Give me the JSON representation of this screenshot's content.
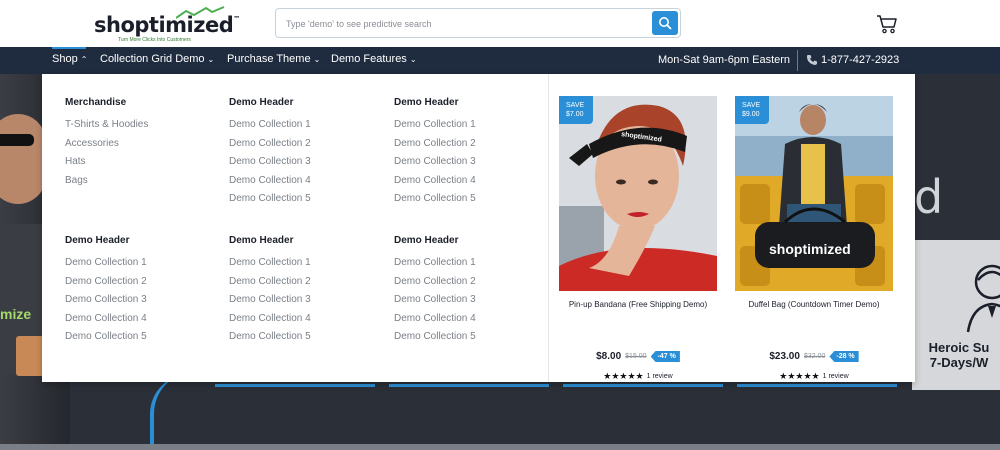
{
  "header": {
    "logo_text": "shoptimized",
    "logo_tm": "™",
    "logo_tagline": "Turn More Clicks Into Customers",
    "search_placeholder": "Type 'demo' to see predictive search"
  },
  "nav": {
    "items": [
      {
        "label": "Shop"
      },
      {
        "label": "Collection Grid Demo"
      },
      {
        "label": "Purchase Theme"
      },
      {
        "label": "Demo Features"
      }
    ],
    "hours": "Mon-Sat 9am-6pm Eastern",
    "phone": "1-877-427-2923"
  },
  "mega": {
    "columns": [
      {
        "header": "Merchandise",
        "links": [
          "T-Shirts & Hoodies",
          "Accessories",
          "Hats",
          "Bags"
        ]
      },
      {
        "header": "Demo Header",
        "links": [
          "Demo Collection 1",
          "Demo Collection 2",
          "Demo Collection 3",
          "Demo Collection 4",
          "Demo Collection 5"
        ]
      },
      {
        "header": "Demo Header",
        "links": [
          "Demo Collection 1",
          "Demo Collection 2",
          "Demo Collection 3",
          "Demo Collection 4",
          "Demo Collection 5"
        ]
      },
      {
        "header": "Demo Header",
        "links": [
          "Demo Collection 1",
          "Demo Collection 2",
          "Demo Collection 3",
          "Demo Collection 4",
          "Demo Collection 5"
        ]
      },
      {
        "header": "Demo Header",
        "links": [
          "Demo Collection 1",
          "Demo Collection 2",
          "Demo Collection 3",
          "Demo Collection 4",
          "Demo Collection 5"
        ]
      },
      {
        "header": "Demo Header",
        "links": [
          "Demo Collection 1",
          "Demo Collection 2",
          "Demo Collection 3",
          "Demo Collection 4",
          "Demo Collection 5"
        ]
      }
    ],
    "products": [
      {
        "save_label": "SAVE",
        "save_amount": "$7.00",
        "name": "Pin-up Bandana (Free Shipping Demo)",
        "price": "$8.00",
        "compare": "$15.00",
        "discount": "-47 %",
        "stars": "★★★★★",
        "reviews": "1 review",
        "product_logo": "shoptimized"
      },
      {
        "save_label": "SAVE",
        "save_amount": "$9.00",
        "name": "Duffel Bag (Countdown Timer Demo)",
        "price": "$23.00",
        "compare": "$32.00",
        "discount": "-28 %",
        "stars": "★★★★★",
        "reviews": "1 review",
        "product_logo": "shoptimized"
      }
    ]
  },
  "hero": {
    "shirt_text": "mize",
    "big_letter": "d",
    "promo_text_line1": "Heroic Su",
    "promo_text_line2": "7-Days/W"
  },
  "colors": {
    "accent": "#2a8fd6",
    "nav_bg": "#1f2c3f",
    "text_dark": "#1b1f2a",
    "link_gray": "#7b8088"
  }
}
